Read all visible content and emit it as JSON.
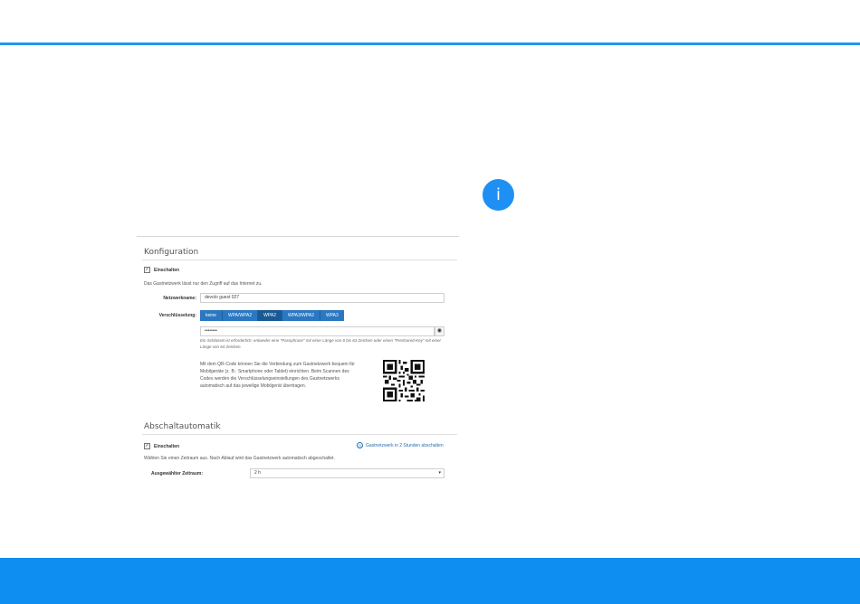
{
  "colors": {
    "accent": "#2196f3",
    "footer": "#0f8ef2",
    "segment": "#2a78c2",
    "segment_active": "#195a95"
  },
  "info": {
    "glyph": "i",
    "icon": "info-icon"
  },
  "config": {
    "title": "Konfiguration",
    "enable_label": "Einschalten",
    "description": "Das Gastnetzwerk lässt nur den Zugriff auf das Internet zu.",
    "network_name_label": "Netzwerkname:",
    "network_name_value": "devolo guest 027",
    "encryption_label": "Verschlüsselung:",
    "encryption_options": [
      "keine",
      "WPA/WPA2",
      "WPA2",
      "WPA3/WPA2",
      "WPA3"
    ],
    "encryption_selected": "WPA2",
    "password_value": "••••••••",
    "hint_line1": "Ein Schlüssel ist erforderlich: entweder eine \"Passphrase\" mit einer Länge von 8 bis 63 Zeichen oder einen \"Preshared-Key\" mit einer",
    "hint_line2": "Länge von 64 Zeichen.",
    "qr_text": [
      "Mit dem QR-Code können Sie die Verbindung zum Gastnetzwerk bequem für",
      "Mobilgeräte (z. B.: Smartphone oder Tablet) einrichten. Beim Scannen des",
      "Codes werden die Verschlüsselungseinstellungen des Gastnetzwerks",
      "automatisch auf das jeweilige Mobilgerät übertragen."
    ]
  },
  "auto_off": {
    "title": "Abschaltautomatik",
    "enable_label": "Einschalten",
    "link_text": "Gastnetzwerk in 2 Stunden abschalten",
    "description": "Wählen Sie einen Zeitraum aus. Nach Ablauf wird das Gastnetzwerk automatisch abgeschaltet.",
    "period_label": "Ausgewählter Zeitraum:",
    "period_value": "2 h"
  }
}
